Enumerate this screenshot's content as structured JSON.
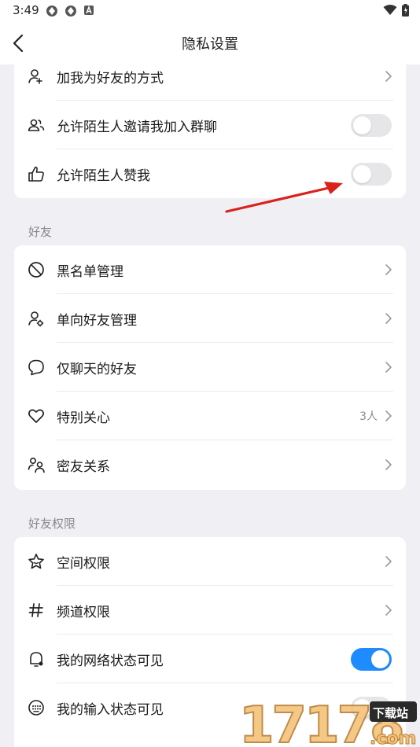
{
  "status_bar": {
    "time": "3:49",
    "icons": [
      "app-notification-icon",
      "app-notification-icon",
      "a-notification-icon",
      "wifi-icon",
      "battery-icon"
    ]
  },
  "header": {
    "title": "隐私设置",
    "back_icon": "chevron-left-icon"
  },
  "card1": {
    "rows": [
      {
        "label": "加我为好友的方式",
        "icon": "person-add-icon",
        "control": "chevron"
      },
      {
        "label": "允许陌生人邀请我加入群聊",
        "icon": "group-icon",
        "control": "toggle",
        "toggle_on": false
      },
      {
        "label": "允许陌生人赞我",
        "icon": "thumbs-up-icon",
        "control": "toggle",
        "toggle_on": false
      }
    ]
  },
  "friends_section": {
    "title": "好友",
    "rows": [
      {
        "label": "黑名单管理",
        "icon": "block-icon",
        "control": "chevron"
      },
      {
        "label": "单向好友管理",
        "icon": "person-gear-icon",
        "control": "chevron"
      },
      {
        "label": "仅聊天的好友",
        "icon": "chat-bubble-icon",
        "control": "chevron"
      },
      {
        "label": "特别关心",
        "icon": "heart-icon",
        "control": "chevron",
        "value": "3人"
      },
      {
        "label": "密友关系",
        "icon": "close-friends-icon",
        "control": "chevron"
      }
    ]
  },
  "permissions_section": {
    "title": "好友权限",
    "rows": [
      {
        "label": "空间权限",
        "icon": "star-icon",
        "control": "chevron"
      },
      {
        "label": "频道权限",
        "icon": "hashtag-icon",
        "control": "chevron"
      },
      {
        "label": "我的网络状态可见",
        "icon": "status-bell-icon",
        "control": "toggle",
        "toggle_on": true
      },
      {
        "label": "我的输入状态可见",
        "icon": "keyboard-icon",
        "control": "toggle",
        "toggle_on": false
      }
    ]
  },
  "colors": {
    "background": "#f0f0f4",
    "toggle_on": "#1e8cff",
    "toggle_off": "#e6e6e8",
    "annotation_arrow": "#d9221c"
  },
  "watermark": {
    "number": "17178",
    "tag": "下载站",
    "domain": ".com"
  }
}
